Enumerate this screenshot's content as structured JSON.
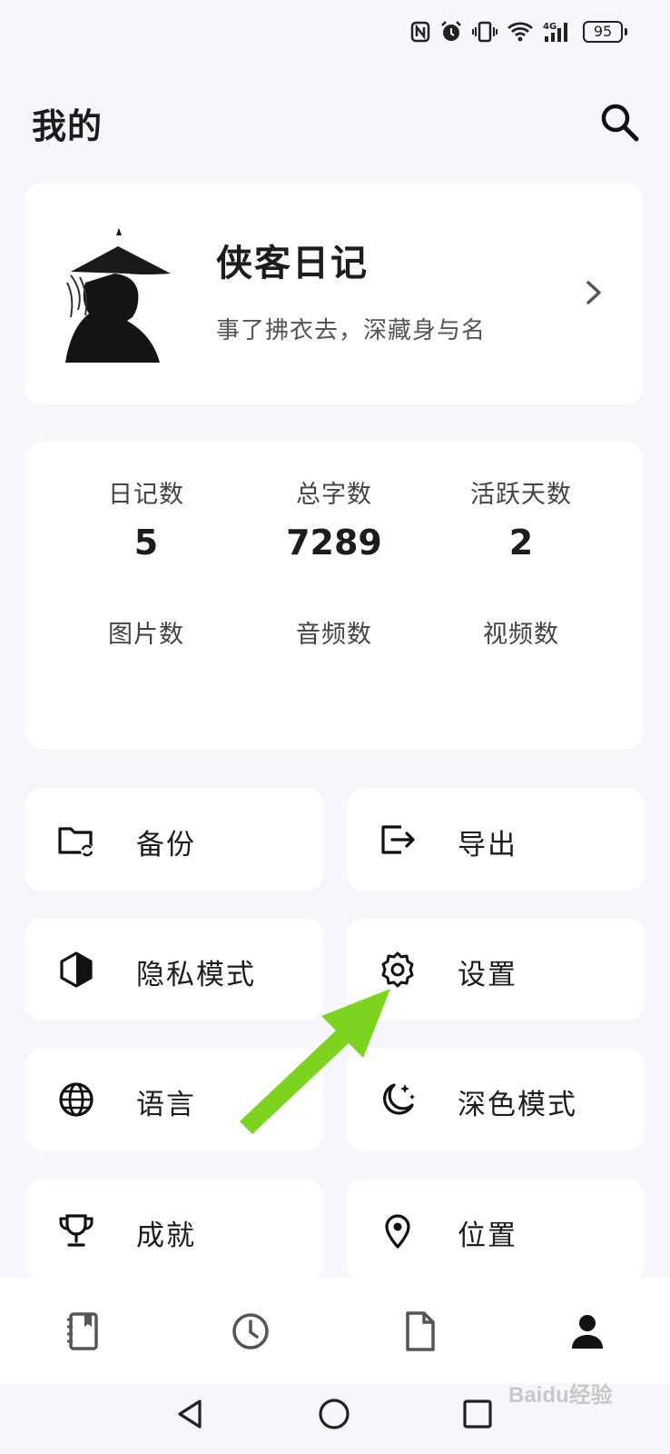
{
  "page": {
    "title": "我的"
  },
  "profile": {
    "name": "侠客日记",
    "motto": "事了拂衣去，深藏身与名"
  },
  "stats": [
    {
      "label": "日记数",
      "value": "5"
    },
    {
      "label": "总字数",
      "value": "7289"
    },
    {
      "label": "活跃天数",
      "value": "2"
    },
    {
      "label": "图片数",
      "value": ""
    },
    {
      "label": "音频数",
      "value": ""
    },
    {
      "label": "视频数",
      "value": ""
    }
  ],
  "menu": [
    {
      "label": "备份",
      "icon": "folder-sync-icon"
    },
    {
      "label": "导出",
      "icon": "export-icon"
    },
    {
      "label": "隐私模式",
      "icon": "privacy-shield-icon"
    },
    {
      "label": "设置",
      "icon": "gear-icon"
    },
    {
      "label": "语言",
      "icon": "globe-icon"
    },
    {
      "label": "深色模式",
      "icon": "moon-stars-icon"
    },
    {
      "label": "成就",
      "icon": "trophy-icon"
    },
    {
      "label": "位置",
      "icon": "location-pin-icon"
    }
  ],
  "status": {
    "battery": "95",
    "network": "4G"
  },
  "bottom_nav": [
    {
      "name": "diary",
      "icon": "notebook-icon"
    },
    {
      "name": "timeline",
      "icon": "clock-icon"
    },
    {
      "name": "documents",
      "icon": "document-icon"
    },
    {
      "name": "me",
      "icon": "person-icon",
      "active": true
    }
  ],
  "watermark": "Baidu经验",
  "colors": {
    "background": "#f6f7fb",
    "card": "#ffffff",
    "text": "#1c1c1c",
    "annotation_arrow": "#7ed321"
  }
}
